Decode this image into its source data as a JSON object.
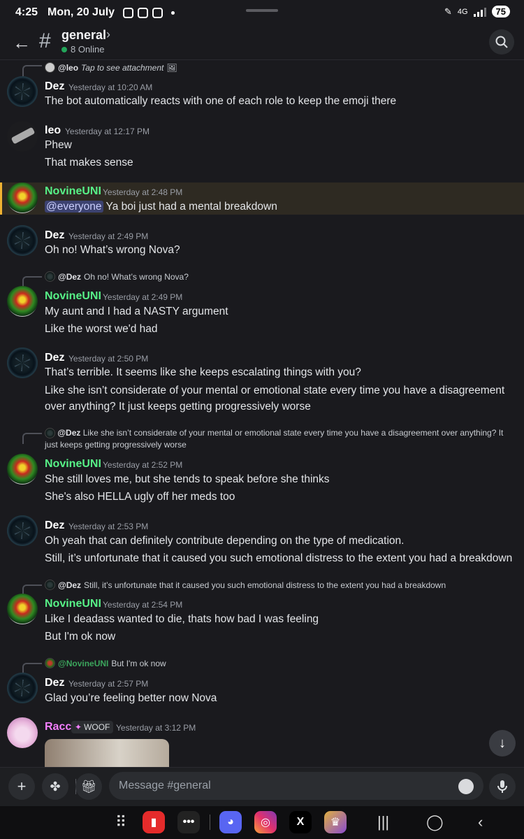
{
  "status": {
    "time": "4:25",
    "date": "Mon, 20 July",
    "battery": "75",
    "network": "4G"
  },
  "header": {
    "channel": "general",
    "online": "8 Online"
  },
  "messages": [
    {
      "reply": {
        "user": "@leo",
        "text": "Tap to see attachment"
      }
    },
    {
      "user": "Dez",
      "time": "Yesterday at 10:20 AM",
      "lines": [
        "The bot automatically reacts with one of each role to keep the emoji there"
      ]
    },
    {
      "user": "leo",
      "time": "Yesterday at 12:17 PM",
      "lines": [
        "Phew",
        "That makes sense"
      ]
    },
    {
      "user": "NovineUNI",
      "time": "Yesterday at 2:48 PM",
      "mention": "@everyone",
      "lines": [
        "Ya boi just had a mental breakdown"
      ]
    },
    {
      "user": "Dez",
      "time": "Yesterday at 2:49 PM",
      "lines": [
        "Oh no! What’s wrong Nova?"
      ]
    },
    {
      "reply": {
        "user": "@Dez",
        "text": "Oh no! What’s wrong Nova?"
      },
      "user": "NovineUNI",
      "time": "Yesterday at 2:49 PM",
      "lines": [
        "My aunt and I had a NASTY argument",
        "Like the worst we'd had"
      ]
    },
    {
      "user": "Dez",
      "time": "Yesterday at 2:50 PM",
      "lines": [
        "That’s terrible. It seems like she keeps escalating things with you?",
        "Like she isn’t considerate of your mental or emotional state every time you have a disagreement over anything? It just keeps getting progressively worse"
      ]
    },
    {
      "reply": {
        "user": "@Dez",
        "text": "Like she isn’t considerate of your mental or emotional state every time you have a disagreement over anything? It just keeps getting progressively worse"
      },
      "user": "NovineUNI",
      "time": "Yesterday at 2:52 PM",
      "lines": [
        "She still loves me, but she tends to speak before she thinks",
        "She's also HELLA ugly off her meds too"
      ]
    },
    {
      "user": "Dez",
      "time": "Yesterday at 2:53 PM",
      "lines": [
        "Oh yeah that can definitely contribute depending on the type of medication.",
        "Still, it’s unfortunate that it caused you such emotional distress to the extent you had a breakdown"
      ]
    },
    {
      "reply": {
        "user": "@Dez",
        "text": "Still, it’s unfortunate that it caused you such emotional distress to the extent you had a breakdown"
      },
      "user": "NovineUNI",
      "time": "Yesterday at 2:54 PM",
      "lines": [
        "Like I deadass wanted to die, thats how bad I was feeling",
        "But I'm ok now"
      ]
    },
    {
      "reply": {
        "user": "@NovineUNI",
        "text": "But I'm ok now"
      },
      "user": "Dez",
      "time": "Yesterday at 2:57 PM",
      "lines": [
        "Glad you’re feeling better now Nova"
      ]
    },
    {
      "user": "Racc",
      "role": "WOOF",
      "time": "Yesterday at 3:12 PM"
    }
  ],
  "composer": {
    "placeholder": "Message #general"
  },
  "colors": {
    "dez": "#ffffff",
    "novine": "#57f287",
    "racc": "#f47fff",
    "online": "#23a55a",
    "mention_bar": "#f0b232"
  },
  "icons": [
    "back-arrow-icon",
    "hash-icon",
    "search-icon",
    "plus-icon",
    "apps-icon",
    "gift-icon",
    "emoji-icon",
    "mic-icon",
    "arrow-down-icon"
  ]
}
